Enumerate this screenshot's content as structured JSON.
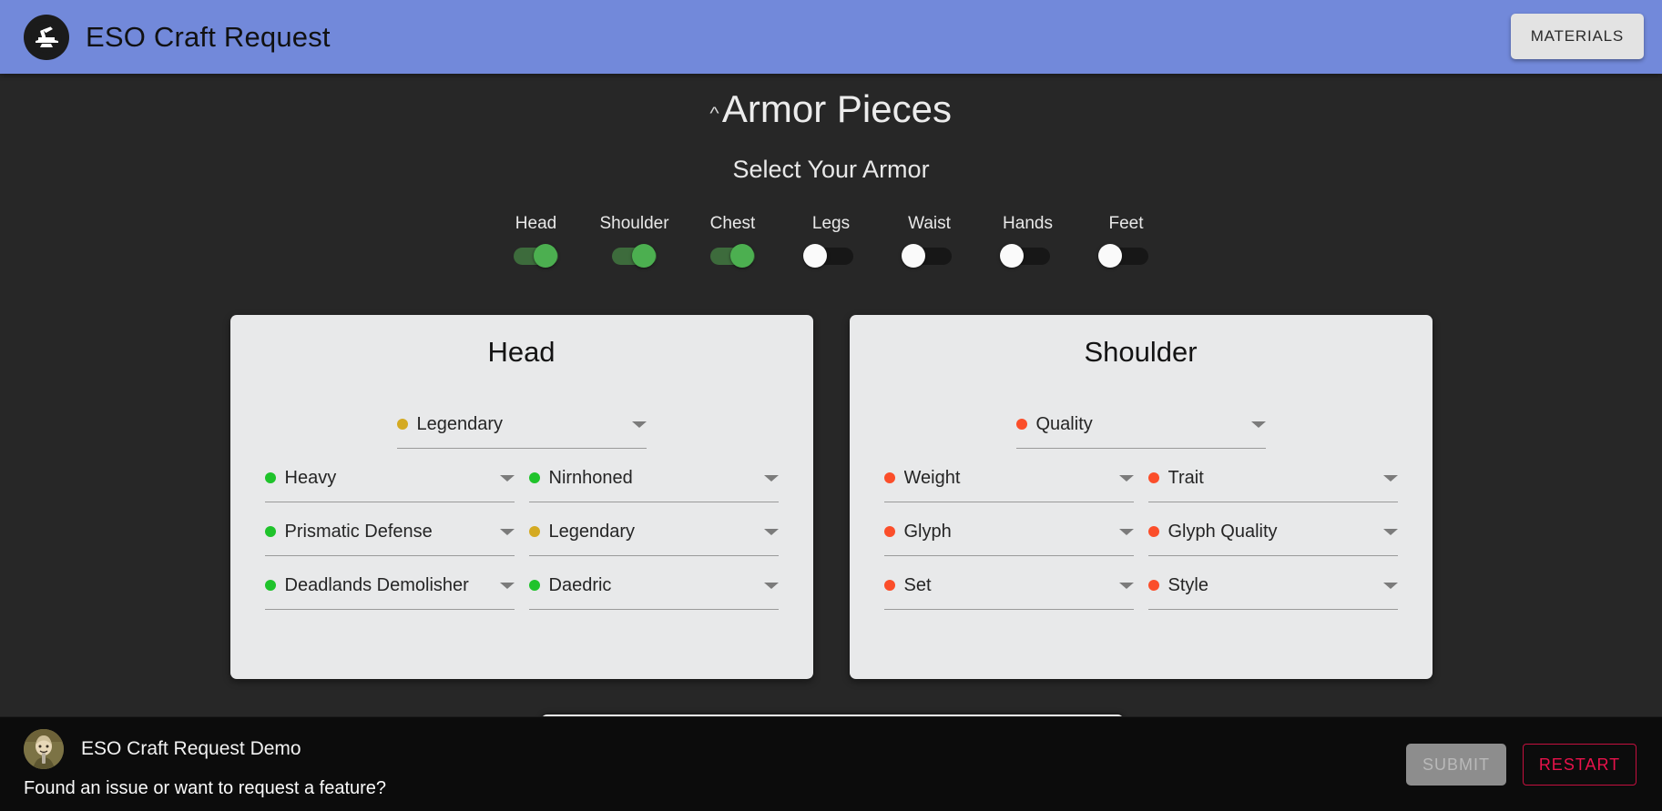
{
  "header": {
    "logo_icon": "anvil-hammer-icon",
    "title": "ESO Craft Request",
    "materials_button": "MATERIALS",
    "background_color": "#7289da"
  },
  "section": {
    "collapse_icon": "chevron-up-icon",
    "title": "Armor Pieces",
    "subtitle": "Select Your Armor"
  },
  "armor_toggles": [
    {
      "label": "Head",
      "on": true
    },
    {
      "label": "Shoulder",
      "on": true
    },
    {
      "label": "Chest",
      "on": true
    },
    {
      "label": "Legs",
      "on": false
    },
    {
      "label": "Waist",
      "on": false
    },
    {
      "label": "Hands",
      "on": false
    },
    {
      "label": "Feet",
      "on": false
    }
  ],
  "cards": [
    {
      "title": "Head",
      "quality": {
        "value": "Legendary",
        "status": "gold"
      },
      "fields": [
        {
          "value": "Heavy",
          "status": "green"
        },
        {
          "value": "Nirnhoned",
          "status": "green"
        },
        {
          "value": "Prismatic Defense",
          "status": "green"
        },
        {
          "value": "Legendary",
          "status": "gold"
        },
        {
          "value": "Deadlands Demolisher",
          "status": "green"
        },
        {
          "value": "Daedric",
          "status": "green"
        }
      ]
    },
    {
      "title": "Shoulder",
      "quality": {
        "value": "Quality",
        "status": "red"
      },
      "fields": [
        {
          "value": "Weight",
          "status": "red"
        },
        {
          "value": "Trait",
          "status": "red"
        },
        {
          "value": "Glyph",
          "status": "red"
        },
        {
          "value": "Glyph Quality",
          "status": "red"
        },
        {
          "value": "Set",
          "status": "red"
        },
        {
          "value": "Style",
          "status": "red"
        }
      ]
    }
  ],
  "status_colors": {
    "green": "#1fc32b",
    "gold": "#d4aa22",
    "red": "#fb4e2a"
  },
  "footer": {
    "avatar_icon": "user-avatar",
    "name": "ESO Craft Request Demo",
    "prompt": "Found an issue or want to request a feature?",
    "submit_label": "SUBMIT",
    "restart_label": "RESTART"
  }
}
